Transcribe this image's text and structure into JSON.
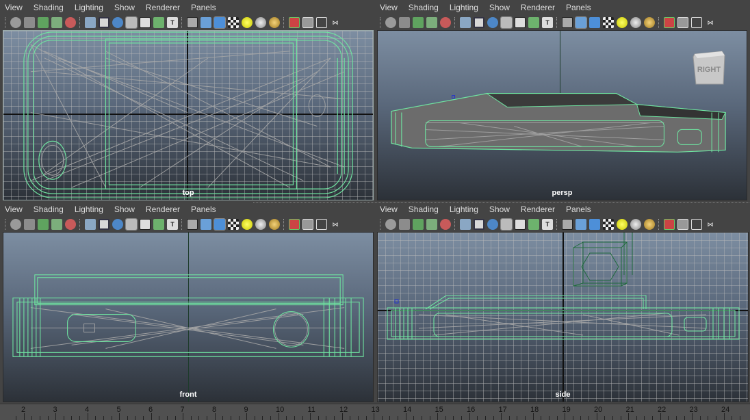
{
  "menus": [
    "View",
    "Shading",
    "Lighting",
    "Show",
    "Renderer",
    "Panels"
  ],
  "panels": [
    {
      "id": "top",
      "camera": "top"
    },
    {
      "id": "persp",
      "camera": "persp"
    },
    {
      "id": "front",
      "camera": "front"
    },
    {
      "id": "side",
      "camera": "side"
    }
  ],
  "viewcube": {
    "label": "RIGHT"
  },
  "toolbar_icons": [
    "select-camera-icon",
    "camera-attributes-icon",
    "bookmark-icon",
    "image-plane-icon",
    "2d-pan-zoom-icon",
    "grid-icon",
    "film-gate-icon",
    "resolution-gate-icon",
    "field-chart-icon",
    "safe-action-icon",
    "safe-title-icon",
    "wireframe-icon",
    "smooth-shade-icon",
    "textured-icon",
    "use-lights-icon",
    "shadows-icon",
    "screen-space-ao-icon",
    "motion-blur-icon",
    "isolate-select-icon",
    "xray-icon",
    "xray-joints-icon",
    "xray-components-icon"
  ],
  "timeline": {
    "ticks": [
      "2",
      "3",
      "4",
      "5",
      "6",
      "7",
      "8",
      "9",
      "10",
      "11",
      "12",
      "13",
      "14",
      "15",
      "16",
      "17",
      "18",
      "19",
      "20",
      "21",
      "22",
      "23",
      "24"
    ]
  },
  "colors": {
    "wire_selected": "#6fe3a0",
    "wire_mesh": "#a7a7a7",
    "axis": "#111111"
  }
}
